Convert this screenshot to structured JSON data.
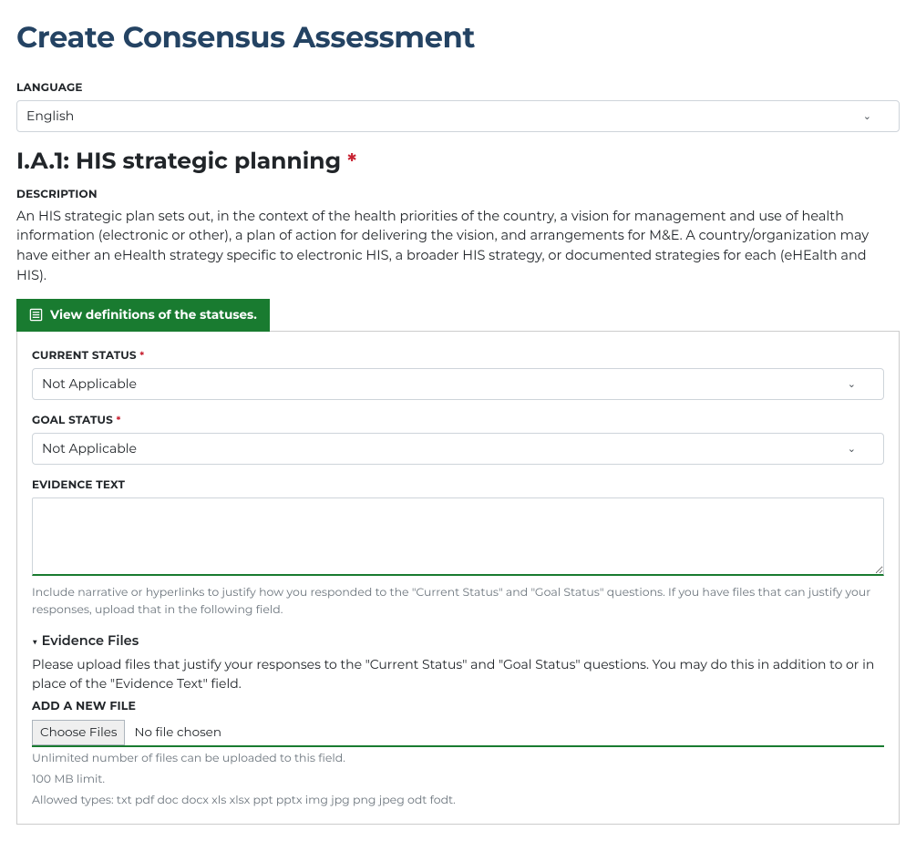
{
  "page_title": "Create Consensus Assessment",
  "language": {
    "label": "LANGUAGE",
    "value": "English"
  },
  "section": {
    "title": "I.A.1: HIS strategic planning",
    "description_label": "DESCRIPTION",
    "description": "An HIS strategic plan sets out, in the context of the health priorities of the country, a vision for management and use of health information (electronic or other), a plan of action for delivering the vision, and arrangements for M&E. A country/organization may have either an eHealth strategy specific to electronic HIS, a broader HIS strategy, or documented strategies for each (eHEalth and HIS)."
  },
  "definitions_button": "View definitions of the statuses.",
  "current_status": {
    "label": "CURRENT STATUS",
    "value": "Not Applicable"
  },
  "goal_status": {
    "label": "GOAL STATUS",
    "value": "Not Applicable"
  },
  "evidence_text": {
    "label": "EVIDENCE TEXT",
    "help": "Include narrative or hyperlinks to justify how you responded to the \"Current Status\" and \"Goal Status\" questions. If you have files that can justify your responses, upload that in the following field."
  },
  "evidence_files": {
    "header": "Evidence Files",
    "description": "Please upload files that justify your responses to the \"Current Status\" and \"Goal Status\" questions. You may do this in addition to or in place of the \"Evidence Text\" field.",
    "add_label": "ADD A NEW FILE",
    "choose_label": "Choose Files",
    "no_file": "No file chosen",
    "help_line1": "Unlimited number of files can be uploaded to this field.",
    "help_line2": "100 MB limit.",
    "help_line3": "Allowed types: txt pdf doc docx xls xlsx ppt pptx img jpg png jpeg odt fodt."
  }
}
